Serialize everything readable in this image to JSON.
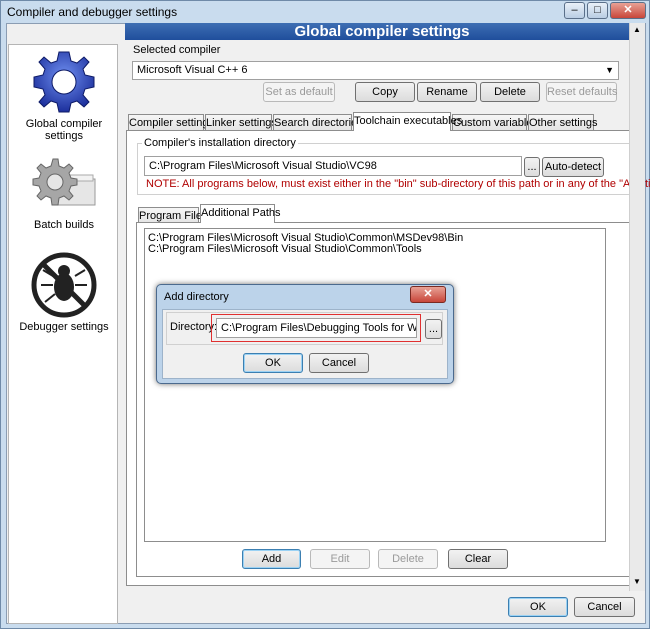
{
  "window": {
    "title": "Compiler and debugger settings"
  },
  "titlebar": {
    "minimize_glyph": "–",
    "maximize_glyph": "□",
    "close_glyph": "✕"
  },
  "header": {
    "title": "Global compiler settings"
  },
  "sidebar": {
    "items": [
      {
        "label": "Global compiler settings",
        "icon": "gear-icon"
      },
      {
        "label": "Batch builds",
        "icon": "batch-gear-icon"
      },
      {
        "label": "Debugger settings",
        "icon": "bug-icon"
      }
    ]
  },
  "compiler": {
    "label": "Selected compiler",
    "value": "Microsoft Visual C++ 6",
    "buttons": {
      "set_default": "Set as default",
      "copy": "Copy",
      "rename": "Rename",
      "delete": "Delete",
      "reset": "Reset defaults"
    }
  },
  "tabs": [
    "Compiler settings",
    "Linker settings",
    "Search directories",
    "Toolchain executables",
    "Custom variables",
    "Other settings"
  ],
  "install": {
    "group_label": "Compiler's installation directory",
    "path": "C:\\Program Files\\Microsoft Visual Studio\\VC98",
    "browse": "...",
    "autodetect": "Auto-detect",
    "note": "NOTE: All programs below, must exist either in the \"bin\" sub-directory of this path or in any of the \"Additional"
  },
  "subtabs": [
    "Program Files",
    "Additional Paths"
  ],
  "paths": [
    "C:\\Program Files\\Microsoft Visual Studio\\Common\\MSDev98\\Bin",
    "C:\\Program Files\\Microsoft Visual Studio\\Common\\Tools"
  ],
  "list_buttons": {
    "add": "Add",
    "edit": "Edit",
    "delete": "Delete",
    "clear": "Clear"
  },
  "footer": {
    "ok": "OK",
    "cancel": "Cancel"
  },
  "dialog": {
    "title": "Add directory",
    "close_glyph": "✕",
    "label": "Directory:",
    "value": "C:\\Program Files\\Debugging Tools for Windows",
    "browse": "...",
    "ok": "OK",
    "cancel": "Cancel"
  },
  "colors": {
    "header_blue": "#2a5aa6",
    "note_red": "#b00000",
    "highlight_red": "#e03030",
    "close_red": "#c8463a"
  }
}
